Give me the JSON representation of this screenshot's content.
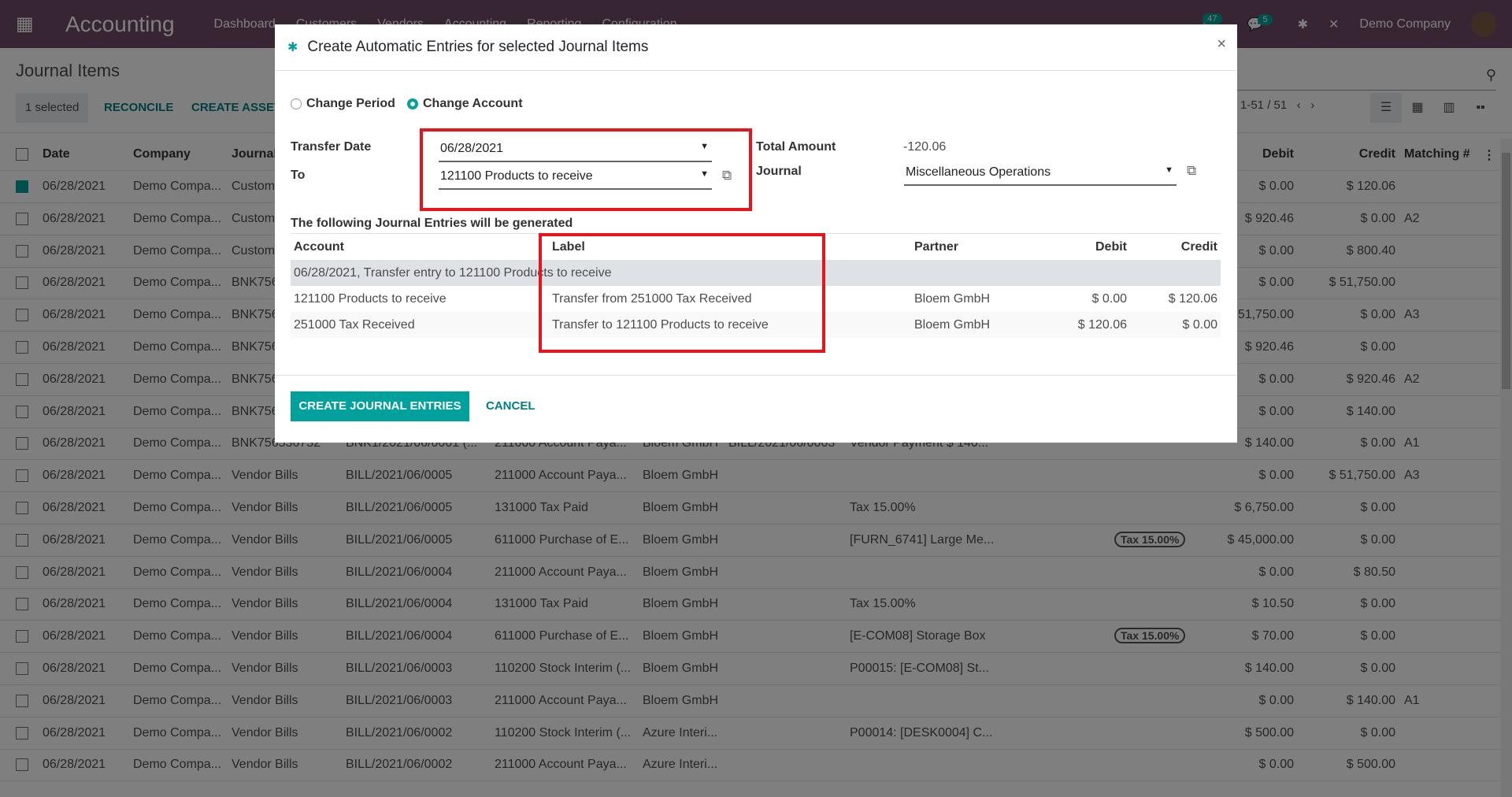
{
  "nav": {
    "app": "Accounting",
    "menus": [
      "Dashboard",
      "Customers",
      "Vendors",
      "Accounting",
      "Reporting",
      "Configuration"
    ],
    "activity_count": "47",
    "message_count": "5",
    "company": "Demo Company",
    "brand_color": "#714b67"
  },
  "cp": {
    "title": "Journal Items",
    "selected": "1 selected",
    "reconcile": "RECONCILE",
    "create_asset": "CREATE ASSET",
    "pager": "1-51 / 51"
  },
  "list": {
    "headers": {
      "date": "Date",
      "company": "Company",
      "journal": "Journal",
      "debit": "Debit",
      "credit": "Credit",
      "matching": "Matching #"
    },
    "rows": [
      {
        "checked": true,
        "date": "06/28/2021",
        "company": "Demo Compa...",
        "journal": "Custom",
        "move": "",
        "account": "",
        "partner": "",
        "ref": "",
        "label": "",
        "tax": "",
        "debit": "$ 0.00",
        "credit": "$ 120.06",
        "match": ""
      },
      {
        "date": "06/28/2021",
        "company": "Demo Compa...",
        "journal": "Custom",
        "debit": "$ 920.46",
        "credit": "$ 0.00",
        "match": "A2"
      },
      {
        "date": "06/28/2021",
        "company": "Demo Compa...",
        "journal": "Custom",
        "debit": "$ 0.00",
        "credit": "$ 800.40",
        "match": ""
      },
      {
        "date": "06/28/2021",
        "company": "Demo Compa...",
        "journal": "BNK756",
        "debit": "$ 0.00",
        "credit": "$ 51,750.00",
        "match": ""
      },
      {
        "date": "06/28/2021",
        "company": "Demo Compa...",
        "journal": "BNK756",
        "debit": "$ 51,750.00",
        "credit": "$ 0.00",
        "match": "A3"
      },
      {
        "date": "06/28/2021",
        "company": "Demo Compa...",
        "journal": "BNK756",
        "debit": "$ 920.46",
        "credit": "$ 0.00",
        "match": ""
      },
      {
        "date": "06/28/2021",
        "company": "Demo Compa...",
        "journal": "BNK756",
        "debit": "$ 0.00",
        "credit": "$ 920.46",
        "match": "A2"
      },
      {
        "date": "06/28/2021",
        "company": "Demo Compa...",
        "journal": "BNK756",
        "debit": "$ 0.00",
        "credit": "$ 140.00",
        "match": ""
      },
      {
        "date": "06/28/2021",
        "company": "Demo Compa...",
        "journal": "BNK756536732",
        "move": "BNK1/2021/06/0001 (...",
        "account": "211000 Account Paya...",
        "partner": "Bloem GmbH",
        "ref": "BILL/2021/06/0003",
        "label": "Vendor Payment $ 140...",
        "debit": "$ 140.00",
        "credit": "$ 0.00",
        "match": "A1"
      },
      {
        "date": "06/28/2021",
        "company": "Demo Compa...",
        "journal": "Vendor Bills",
        "move": "BILL/2021/06/0005",
        "account": "211000 Account Paya...",
        "partner": "Bloem GmbH",
        "debit": "$ 0.00",
        "credit": "$ 51,750.00",
        "match": "A3"
      },
      {
        "date": "06/28/2021",
        "company": "Demo Compa...",
        "journal": "Vendor Bills",
        "move": "BILL/2021/06/0005",
        "account": "131000 Tax Paid",
        "partner": "Bloem GmbH",
        "label": "Tax 15.00%",
        "debit": "$ 6,750.00",
        "credit": "$ 0.00",
        "match": ""
      },
      {
        "date": "06/28/2021",
        "company": "Demo Compa...",
        "journal": "Vendor Bills",
        "move": "BILL/2021/06/0005",
        "account": "611000 Purchase of E...",
        "partner": "Bloem GmbH",
        "label": "[FURN_6741] Large Me...",
        "tax": "Tax 15.00%",
        "debit": "$ 45,000.00",
        "credit": "$ 0.00",
        "match": ""
      },
      {
        "date": "06/28/2021",
        "company": "Demo Compa...",
        "journal": "Vendor Bills",
        "move": "BILL/2021/06/0004",
        "account": "211000 Account Paya...",
        "partner": "Bloem GmbH",
        "debit": "$ 0.00",
        "credit": "$ 80.50",
        "match": ""
      },
      {
        "date": "06/28/2021",
        "company": "Demo Compa...",
        "journal": "Vendor Bills",
        "move": "BILL/2021/06/0004",
        "account": "131000 Tax Paid",
        "partner": "Bloem GmbH",
        "label": "Tax 15.00%",
        "debit": "$ 10.50",
        "credit": "$ 0.00",
        "match": ""
      },
      {
        "date": "06/28/2021",
        "company": "Demo Compa...",
        "journal": "Vendor Bills",
        "move": "BILL/2021/06/0004",
        "account": "611000 Purchase of E...",
        "partner": "Bloem GmbH",
        "label": "[E-COM08] Storage Box",
        "tax": "Tax 15.00%",
        "debit": "$ 70.00",
        "credit": "$ 0.00",
        "match": ""
      },
      {
        "date": "06/28/2021",
        "company": "Demo Compa...",
        "journal": "Vendor Bills",
        "move": "BILL/2021/06/0003",
        "account": "110200 Stock Interim (...",
        "partner": "Bloem GmbH",
        "label": "P00015: [E-COM08] St...",
        "debit": "$ 140.00",
        "credit": "$ 0.00",
        "match": ""
      },
      {
        "date": "06/28/2021",
        "company": "Demo Compa...",
        "journal": "Vendor Bills",
        "move": "BILL/2021/06/0003",
        "account": "211000 Account Paya...",
        "partner": "Bloem GmbH",
        "debit": "$ 0.00",
        "credit": "$ 140.00",
        "match": "A1"
      },
      {
        "date": "06/28/2021",
        "company": "Demo Compa...",
        "journal": "Vendor Bills",
        "move": "BILL/2021/06/0002",
        "account": "110200 Stock Interim (...",
        "partner": "Azure Interi...",
        "label": "P00014: [DESK0004] C...",
        "debit": "$ 500.00",
        "credit": "$ 0.00",
        "match": ""
      },
      {
        "date": "06/28/2021",
        "company": "Demo Compa...",
        "journal": "Vendor Bills",
        "move": "BILL/2021/06/0002",
        "account": "211000 Account Paya...",
        "partner": "Azure Interi...",
        "debit": "$ 0.00",
        "credit": "$ 500.00",
        "match": ""
      }
    ]
  },
  "dialog": {
    "title": "Create Automatic Entries for selected Journal Items",
    "close": "×",
    "radio_period": "Change Period",
    "radio_account": "Change Account",
    "selected_radio": "Change Account",
    "transfer_date_label": "Transfer Date",
    "transfer_date": "06/28/2021",
    "to_label": "To",
    "to_value": "121100 Products to receive",
    "total_label": "Total Amount",
    "total_value": "-120.06",
    "journal_label": "Journal",
    "journal_value": "Miscellaneous Operations",
    "section": "The following Journal Entries will be generated",
    "cols": {
      "account": "Account",
      "label": "Label",
      "partner": "Partner",
      "debit": "Debit",
      "credit": "Credit"
    },
    "group": "06/28/2021, Transfer entry to 121100 Products to receive",
    "lines": [
      {
        "account": "121100 Products to receive",
        "label": "Transfer from 251000 Tax Received",
        "partner": "Bloem GmbH",
        "debit": "$ 0.00",
        "credit": "$ 120.06"
      },
      {
        "account": "251000 Tax Received",
        "label": "Transfer to 121100 Products to receive",
        "partner": "Bloem GmbH",
        "debit": "$ 120.06",
        "credit": "$ 0.00"
      }
    ],
    "create": "CREATE JOURNAL ENTRIES",
    "cancel": "CANCEL",
    "accent": "#00a09d",
    "highlight": "#e8141c"
  }
}
